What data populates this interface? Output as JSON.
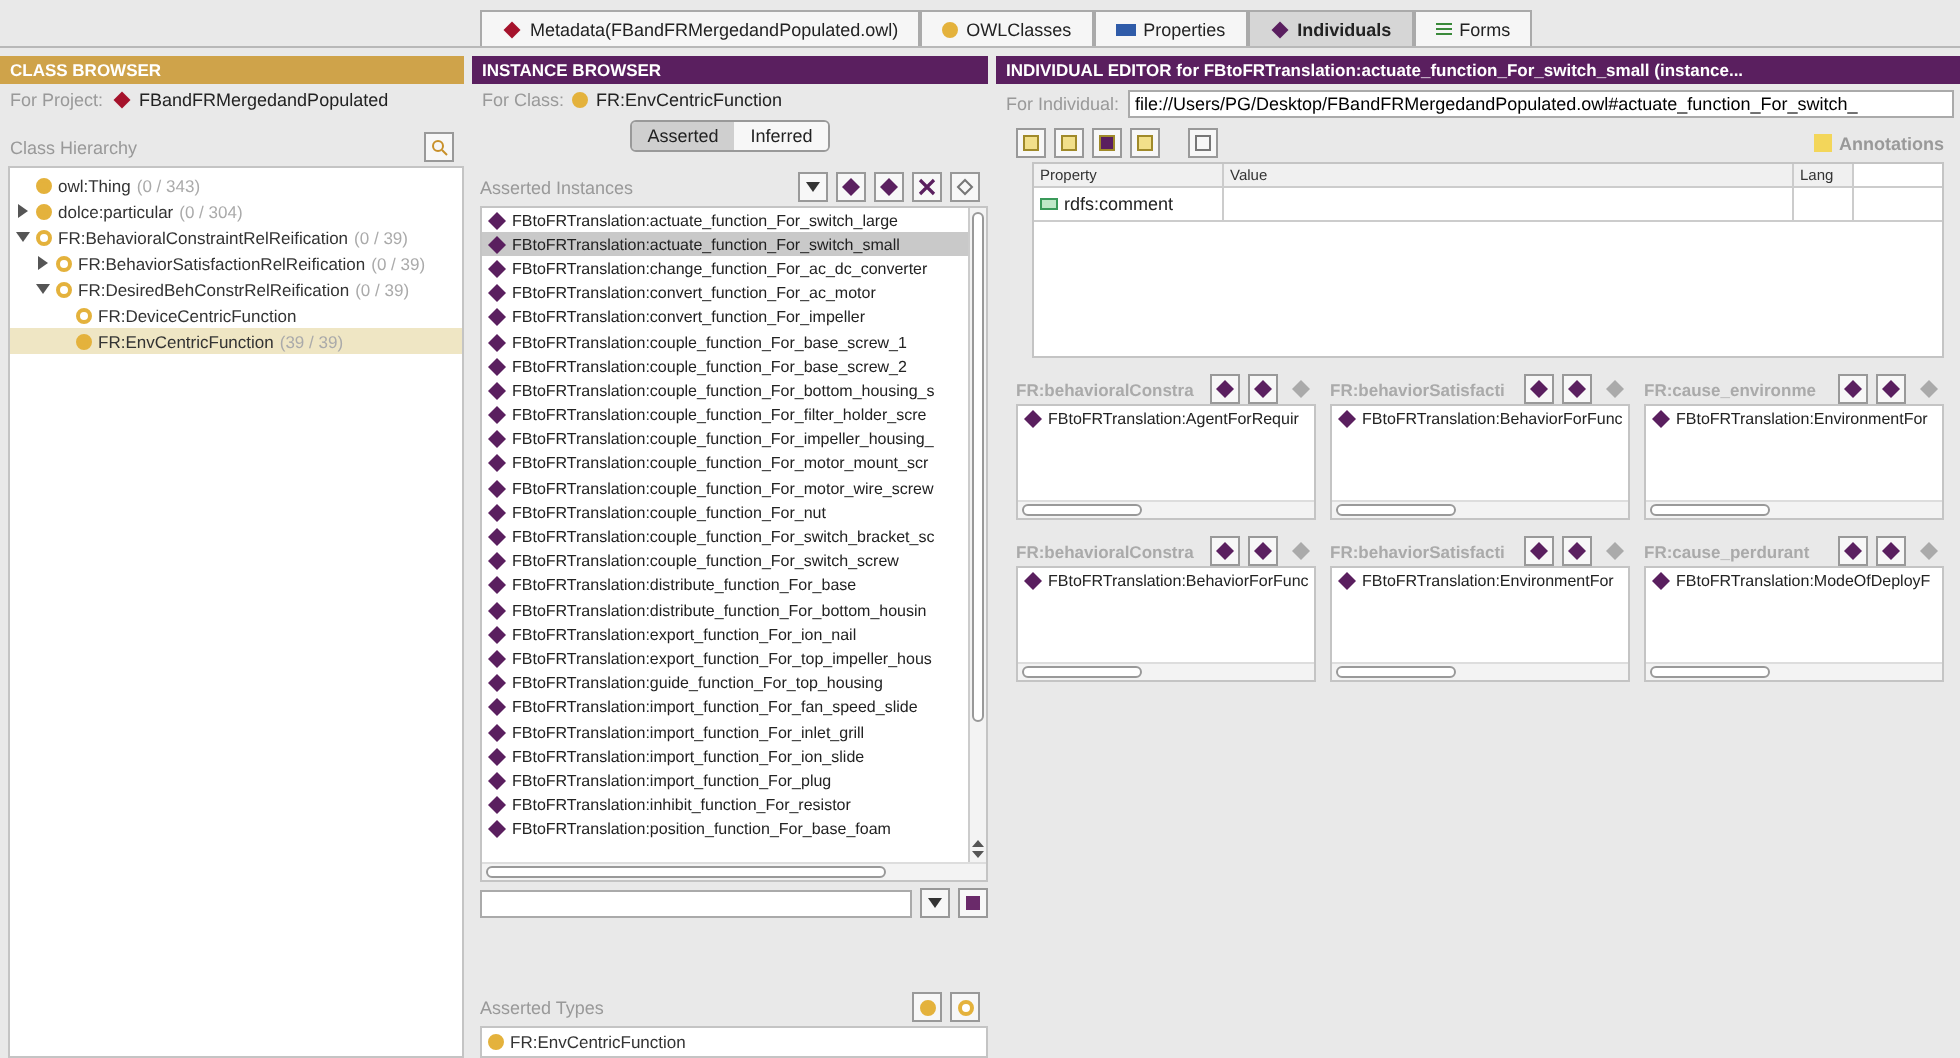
{
  "tabs": [
    {
      "label": "Metadata(FBandFRMergedandPopulated.owl)",
      "kind": "diamond",
      "selected": false
    },
    {
      "label": "OWLClasses",
      "kind": "circle",
      "selected": false
    },
    {
      "label": "Properties",
      "kind": "bar",
      "selected": false
    },
    {
      "label": "Individuals",
      "kind": "diamond",
      "selected": true
    },
    {
      "label": "Forms",
      "kind": "lines",
      "selected": false
    }
  ],
  "class_browser": {
    "title": "CLASS BROWSER",
    "project_label": "For Project:",
    "project": "FBandFRMergedandPopulated",
    "hierarchy_label": "Class Hierarchy",
    "tree": [
      {
        "name": "owl:Thing",
        "count": "(0 / 343)",
        "filled": true,
        "selected": false
      },
      {
        "name": "dolce:particular",
        "count": "(0 / 304)",
        "expanded": false,
        "filled": true,
        "selected": false
      },
      {
        "name": "FR:BehavioralConstraintRelReification",
        "count": "(0 / 39)",
        "expanded": true,
        "filled": false,
        "selected": false,
        "children": [
          {
            "name": "FR:BehaviorSatisfactionRelReification",
            "count": "(0 / 39)",
            "expanded": false,
            "filled": false,
            "selected": false
          },
          {
            "name": "FR:DesiredBehConstrRelReification",
            "count": "(0 / 39)",
            "expanded": true,
            "filled": false,
            "selected": false,
            "children": [
              {
                "name": "FR:DeviceCentricFunction",
                "filled": false,
                "selected": false
              },
              {
                "name": "FR:EnvCentricFunction",
                "count": "(39 / 39)",
                "filled": true,
                "selected": true
              }
            ]
          }
        ]
      }
    ]
  },
  "instance_browser": {
    "title": "INSTANCE BROWSER",
    "class_label": "For Class:",
    "class": "FR:EnvCentricFunction",
    "modes": [
      {
        "label": "Asserted",
        "selected": true
      },
      {
        "label": "Inferred",
        "selected": false
      }
    ],
    "list_label": "Asserted Instances",
    "instances": [
      {
        "name": "FBtoFRTranslation:actuate_function_For_switch_large",
        "selected": false
      },
      {
        "name": "FBtoFRTranslation:actuate_function_For_switch_small",
        "selected": true
      },
      {
        "name": "FBtoFRTranslation:change_function_For_ac_dc_converter",
        "selected": false
      },
      {
        "name": "FBtoFRTranslation:convert_function_For_ac_motor",
        "selected": false
      },
      {
        "name": "FBtoFRTranslation:convert_function_For_impeller",
        "selected": false
      },
      {
        "name": "FBtoFRTranslation:couple_function_For_base_screw_1",
        "selected": false
      },
      {
        "name": "FBtoFRTranslation:couple_function_For_base_screw_2",
        "selected": false
      },
      {
        "name": "FBtoFRTranslation:couple_function_For_bottom_housing_s",
        "selected": false
      },
      {
        "name": "FBtoFRTranslation:couple_function_For_filter_holder_scre",
        "selected": false
      },
      {
        "name": "FBtoFRTranslation:couple_function_For_impeller_housing_",
        "selected": false
      },
      {
        "name": "FBtoFRTranslation:couple_function_For_motor_mount_scr",
        "selected": false
      },
      {
        "name": "FBtoFRTranslation:couple_function_For_motor_wire_screw",
        "selected": false
      },
      {
        "name": "FBtoFRTranslation:couple_function_For_nut",
        "selected": false
      },
      {
        "name": "FBtoFRTranslation:couple_function_For_switch_bracket_sc",
        "selected": false
      },
      {
        "name": "FBtoFRTranslation:couple_function_For_switch_screw",
        "selected": false
      },
      {
        "name": "FBtoFRTranslation:distribute_function_For_base",
        "selected": false
      },
      {
        "name": "FBtoFRTranslation:distribute_function_For_bottom_housin",
        "selected": false
      },
      {
        "name": "FBtoFRTranslation:export_function_For_ion_nail",
        "selected": false
      },
      {
        "name": "FBtoFRTranslation:export_function_For_top_impeller_hous",
        "selected": false
      },
      {
        "name": "FBtoFRTranslation:guide_function_For_top_housing",
        "selected": false
      },
      {
        "name": "FBtoFRTranslation:import_function_For_fan_speed_slide",
        "selected": false
      },
      {
        "name": "FBtoFRTranslation:import_function_For_inlet_grill",
        "selected": false
      },
      {
        "name": "FBtoFRTranslation:import_function_For_ion_slide",
        "selected": false
      },
      {
        "name": "FBtoFRTranslation:import_function_For_plug",
        "selected": false
      },
      {
        "name": "FBtoFRTranslation:inhibit_function_For_resistor",
        "selected": false
      },
      {
        "name": "FBtoFRTranslation:position_function_For_base_foam",
        "selected": false
      }
    ],
    "types_label": "Asserted Types",
    "types": [
      "FR:EnvCentricFunction"
    ]
  },
  "individual_editor": {
    "title": "INDIVIDUAL EDITOR for FBtoFRTranslation:actuate_function_For_switch_small  (instance...",
    "individual_label": "For Individual:",
    "individual": "file://Users/PG/Desktop/FBandFRMergedandPopulated.owl#actuate_function_For_switch_",
    "annotations_label": "Annotations",
    "columns": [
      "Property",
      "Value",
      "Lang"
    ],
    "annotations": [
      {
        "property": "rdfs:comment"
      }
    ],
    "slots": [
      {
        "label": "FR:behavioralConstra",
        "value": "FBtoFRTranslation:AgentForRequir"
      },
      {
        "label": "FR:behaviorSatisfacti",
        "value": "FBtoFRTranslation:BehaviorForFunc"
      },
      {
        "label": "FR:cause_environme",
        "value": "FBtoFRTranslation:EnvironmentFor"
      },
      {
        "label": "FR:behavioralConstra",
        "value": "FBtoFRTranslation:BehaviorForFunc"
      },
      {
        "label": "FR:behaviorSatisfacti",
        "value": "FBtoFRTranslation:EnvironmentFor"
      },
      {
        "label": "FR:cause_perdurant",
        "value": "FBtoFRTranslation:ModeOfDeployF"
      }
    ]
  }
}
